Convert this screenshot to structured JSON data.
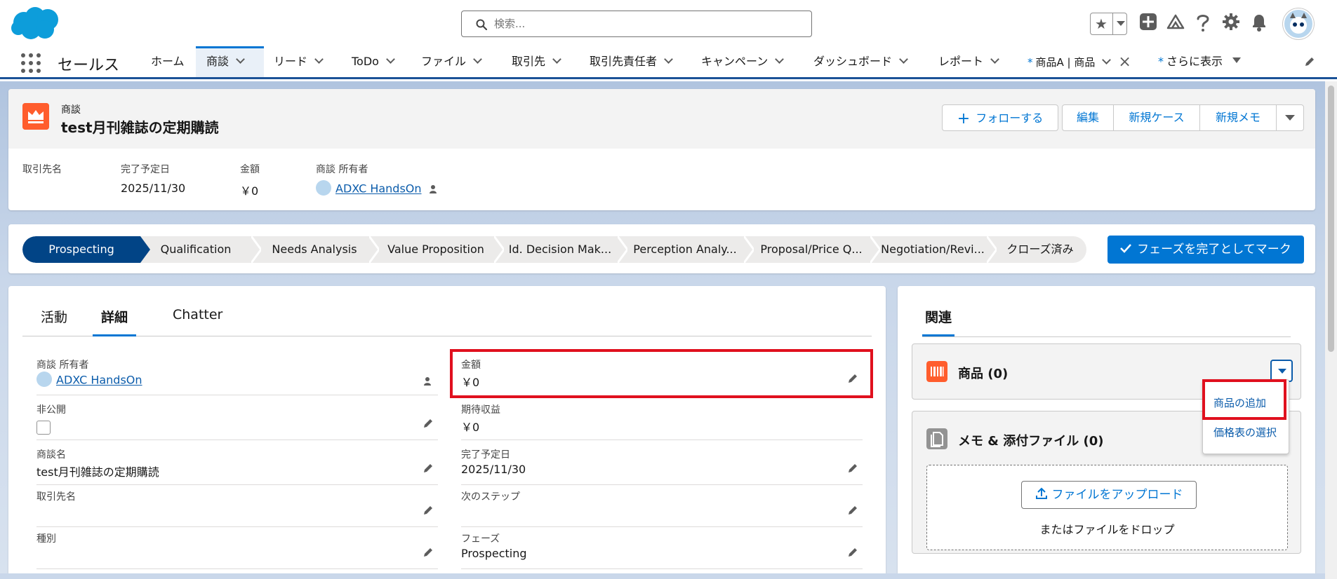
{
  "header": {
    "search_placeholder": "検索..."
  },
  "nav": {
    "app_name": "セールス",
    "items": [
      {
        "label": "ホーム"
      },
      {
        "label": "商談"
      },
      {
        "label": "リード"
      },
      {
        "label": "ToDo"
      },
      {
        "label": "ファイル"
      },
      {
        "label": "取引先"
      },
      {
        "label": "取引先責任者"
      },
      {
        "label": "キャンペーン"
      },
      {
        "label": "ダッシュボード"
      },
      {
        "label": "レポート"
      },
      {
        "label": "商品A | 商品"
      },
      {
        "label": "さらに表示"
      }
    ],
    "tab_modified_marker": "*"
  },
  "record": {
    "object_label": "商談",
    "name": "test月刊雑誌の定期購読",
    "actions": {
      "follow": "フォローする",
      "edit": "編集",
      "new_case": "新規ケース",
      "new_note": "新規メモ"
    },
    "highlights": [
      {
        "label": "取引先名",
        "value": ""
      },
      {
        "label": "完了予定日",
        "value": "2025/11/30"
      },
      {
        "label": "金額",
        "value": "￥0"
      },
      {
        "label": "商談 所有者",
        "value": "ADXC HandsOn"
      }
    ]
  },
  "path": {
    "stages": [
      "Prospecting",
      "Qualification",
      "Needs Analysis",
      "Value Proposition",
      "Id. Decision Mak...",
      "Perception Analy...",
      "Proposal/Price Q...",
      "Negotiation/Revi...",
      "クローズ済み"
    ],
    "current_stage": "Prospecting",
    "mark_complete": "フェーズを完了としてマーク"
  },
  "detail": {
    "tabs": [
      "活動",
      "詳細",
      "Chatter"
    ],
    "active_tab": "詳細",
    "left_fields": [
      {
        "label": "商談 所有者",
        "value": "ADXC HandsOn"
      },
      {
        "label": "非公開",
        "value": ""
      },
      {
        "label": "商談名",
        "value": "test月刊雑誌の定期購読"
      },
      {
        "label": "取引先名",
        "value": ""
      },
      {
        "label": "種別",
        "value": ""
      }
    ],
    "right_fields": [
      {
        "label": "金額",
        "value": "￥0"
      },
      {
        "label": "期待収益",
        "value": "￥0"
      },
      {
        "label": "完了予定日",
        "value": "2025/11/30"
      },
      {
        "label": "次のステップ",
        "value": ""
      },
      {
        "label": "フェーズ",
        "value": "Prospecting"
      }
    ]
  },
  "related": {
    "tab": "関連",
    "products": {
      "title": "商品 (0)"
    },
    "notes": {
      "title": "メモ & 添付ファイル (0)"
    },
    "menu": {
      "add_product": "商品の追加",
      "choose_pricebook": "価格表の選択"
    },
    "upload_button": "ファイルをアップロード",
    "drop_text": "またはファイルをドロップ"
  },
  "colors": {
    "brand": "#0176d3",
    "path_current": "#014486",
    "highlight_red": "#e0101e",
    "opportunity_icon": "#ff5d2d"
  }
}
